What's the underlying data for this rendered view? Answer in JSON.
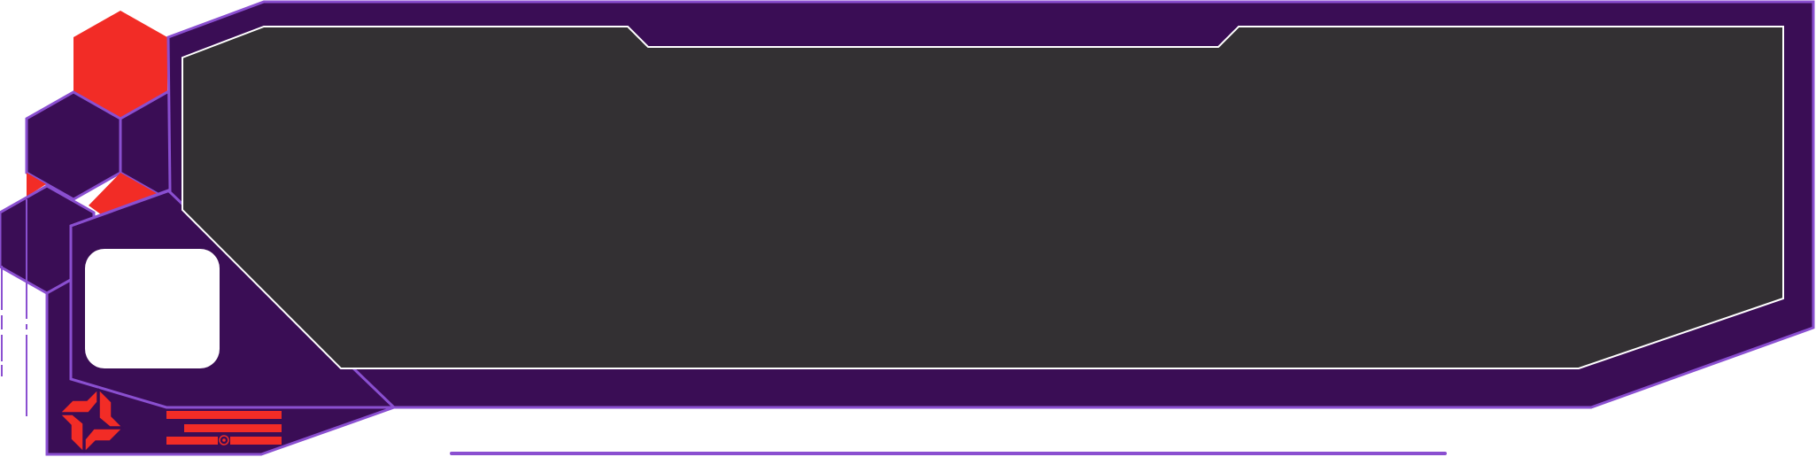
{
  "colors": {
    "panel_purple": "#3a0d55",
    "accent_purple": "#8a4fd0",
    "screen_gray": "#333033",
    "screen_border": "#ffffff",
    "hex_red": "#f22c26",
    "card_white": "#ffffff",
    "page_background": "#ffffff"
  },
  "icons": {
    "logo": "four-arrow-pinwheel-logo",
    "small_mark": "circle-dot-icon"
  }
}
